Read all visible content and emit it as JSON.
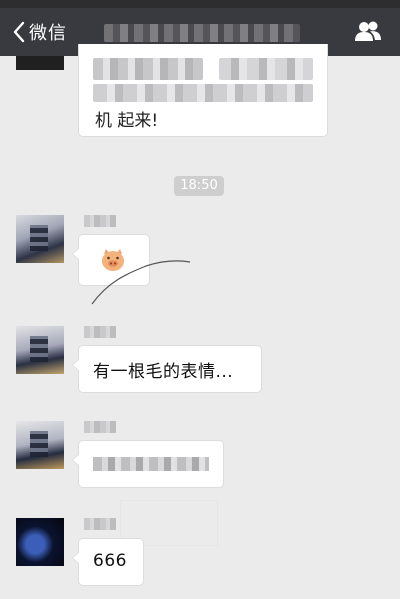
{
  "navbar": {
    "back_label": "微信",
    "contacts_icon": "contacts-icon"
  },
  "chat": {
    "top_message_tail": "机 起来!",
    "timestamp": "18:50",
    "messages": [
      {
        "type": "emoji",
        "emoji": "pig-face-icon"
      },
      {
        "type": "text",
        "text": "有一根毛的表情..."
      },
      {
        "type": "text",
        "text": ""
      },
      {
        "type": "text",
        "text": "666"
      }
    ]
  },
  "colors": {
    "navbar": "#393a3f",
    "background": "#ebebeb",
    "bubble": "#ffffff",
    "timestamp_pill": "#cecece"
  }
}
